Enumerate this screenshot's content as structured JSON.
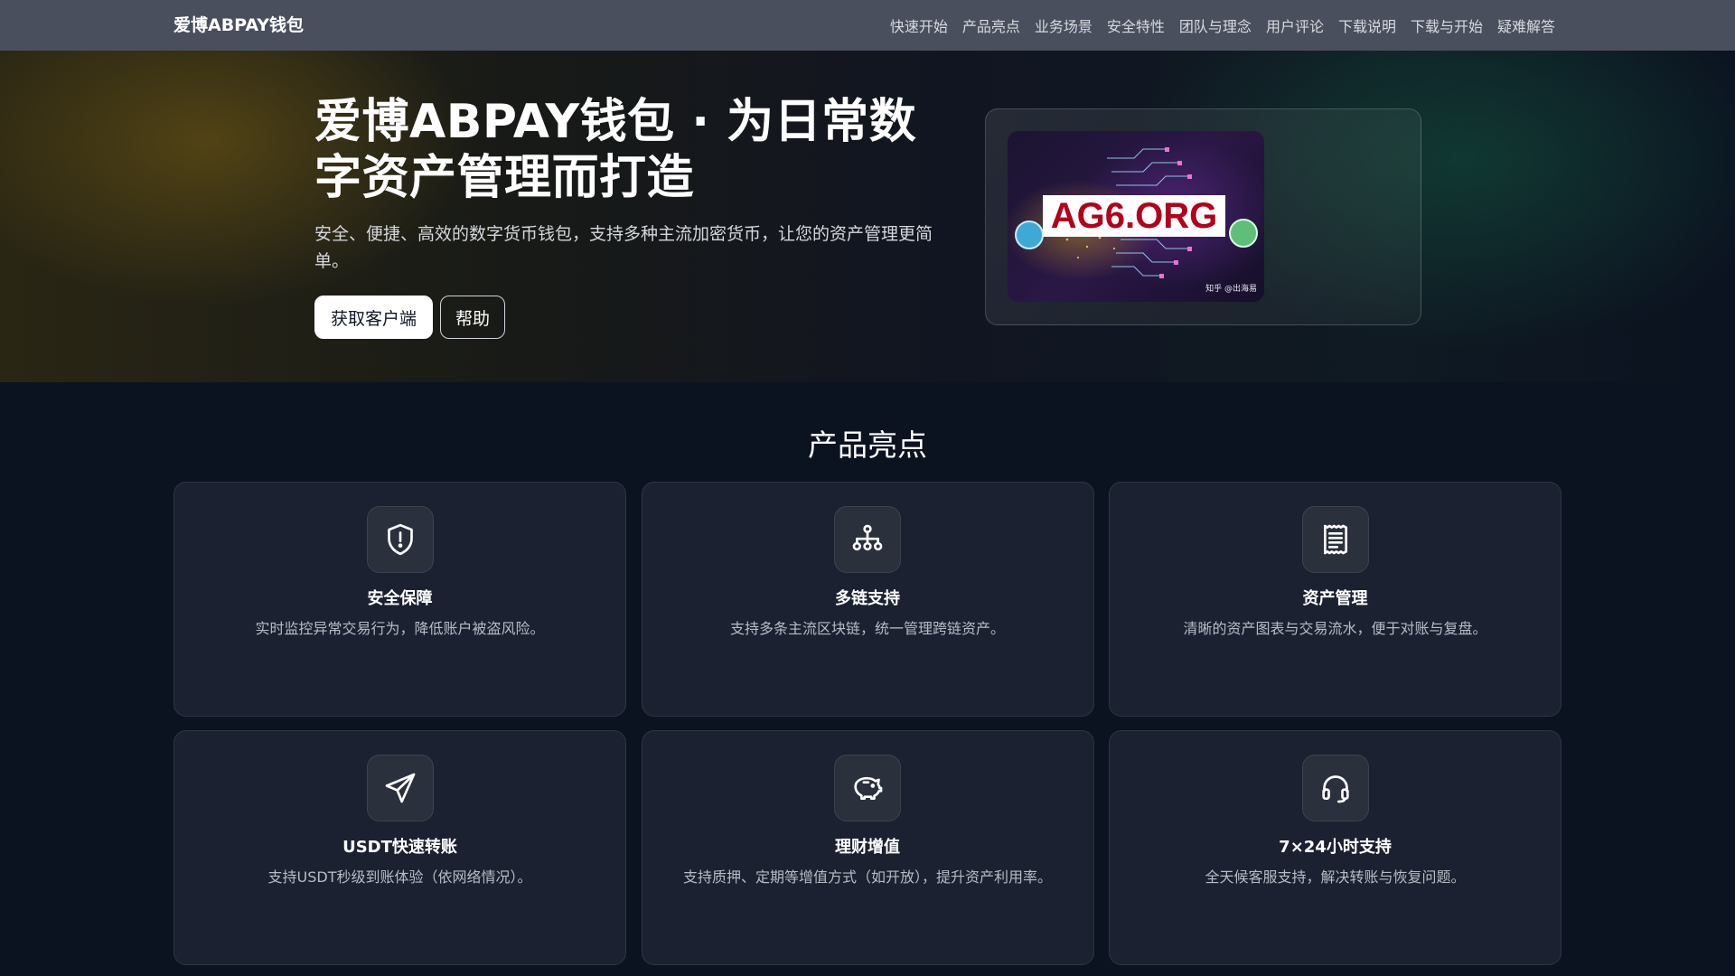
{
  "nav": {
    "brand": "爱博ABPAY钱包",
    "links": [
      "快速开始",
      "产品亮点",
      "业务场景",
      "安全特性",
      "团队与理念",
      "用户评论",
      "下载说明",
      "下载与开始",
      "疑难解答"
    ]
  },
  "hero": {
    "title": "爱博ABPAY钱包 · 为日常数字资产管理而打造",
    "subtitle": "安全、便捷、高效的数字货币钱包，支持多种主流加密货币，让您的资产管理更简单。",
    "primary_button": "获取客户端",
    "secondary_button": "帮助",
    "image": {
      "watermark": "AG6.ORG",
      "credit": "知乎 @出海易"
    }
  },
  "features": {
    "title": "产品亮点",
    "cards": [
      {
        "icon": "shield-alert-icon",
        "title": "安全保障",
        "desc": "实时监控异常交易行为，降低账户被盗风险。"
      },
      {
        "icon": "network-icon",
        "title": "多链支持",
        "desc": "支持多条主流区块链，统一管理跨链资产。"
      },
      {
        "icon": "receipt-icon",
        "title": "资产管理",
        "desc": "清晰的资产图表与交易流水，便于对账与复盘。"
      },
      {
        "icon": "send-icon",
        "title": "USDT快速转账",
        "desc": "支持USDT秒级到账体验（依网络情况）。"
      },
      {
        "icon": "piggy-bank-icon",
        "title": "理财增值",
        "desc": "支持质押、定期等增值方式（如开放），提升资产利用率。"
      },
      {
        "icon": "headset-icon",
        "title": "7×24小时支持",
        "desc": "全天候客服支持，解决转账与恢复问题。"
      }
    ]
  },
  "colors": {
    "nav_bg": "#4a4f5d",
    "page_bg": "#0b1220",
    "card_bg": "#1b2130",
    "watermark_red": "#b3001b"
  }
}
